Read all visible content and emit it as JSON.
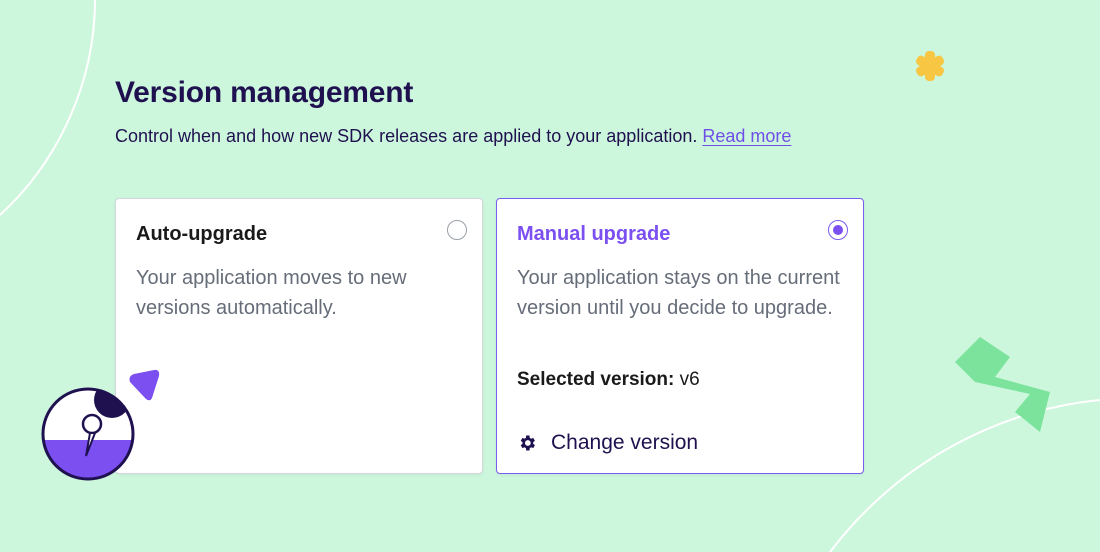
{
  "header": {
    "title": "Version management",
    "subtitle": "Control when and how new SDK releases are applied to your application.",
    "read_more": "Read more"
  },
  "options": {
    "auto": {
      "title": "Auto-upgrade",
      "description": "Your application moves to new versions automatically.",
      "selected": false
    },
    "manual": {
      "title": "Manual upgrade",
      "description": "Your application stays on the current version until you decide to upgrade.",
      "selected": true,
      "selected_version_label": "Selected version:",
      "selected_version_value": "v6",
      "change_version_label": "Change version"
    }
  },
  "icons": {
    "change_version": "gear-icon",
    "radio_on": "radio-selected-icon",
    "radio_off": "radio-unselected-icon"
  },
  "colors": {
    "background": "#cdf7dc",
    "accent": "#7b4ff0",
    "heading": "#1f1150",
    "body_text": "#666d79",
    "decor_yellow": "#f7c744",
    "decor_green": "#7be39c"
  }
}
